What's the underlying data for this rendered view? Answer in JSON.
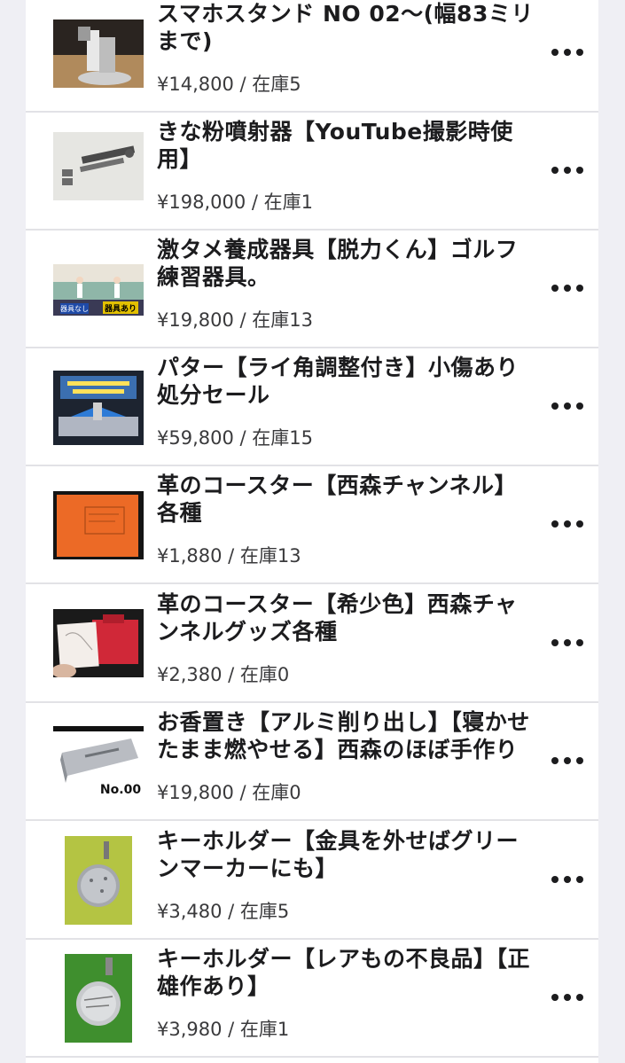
{
  "items": [
    {
      "title": "スマホスタンド NO 02〜(幅83ミリまで)",
      "price": "¥14,800 / 在庫5",
      "thumb_icon": "phone-stand-photo"
    },
    {
      "title": "きな粉噴射器【YouTube撮影時使用】",
      "price": "¥198,000 / 在庫1",
      "thumb_icon": "powder-sprayer-photo"
    },
    {
      "title": "激タメ養成器具【脱力くん】ゴルフ練習器具。",
      "price": "¥19,800 / 在庫13",
      "thumb_icon": "golf-training-photo",
      "thumb_text": [
        "器具なし",
        "器具あり"
      ]
    },
    {
      "title": "パター【ライ角調整付き】小傷あり処分セール",
      "price": "¥59,800 / 在庫15",
      "thumb_icon": "putter-photo"
    },
    {
      "title": "革のコースター【西森チャンネル】各種",
      "price": "¥1,880 / 在庫13",
      "thumb_icon": "leather-coaster-photo"
    },
    {
      "title": "革のコースター【希少色】西森チャンネルグッズ各種",
      "price": "¥2,380 / 在庫0",
      "thumb_icon": "rare-coaster-photo"
    },
    {
      "title": "お香置き【アルミ削り出し】【寝かせたまま燃やせる】西森のほぼ手作り",
      "price": "¥19,800 / 在庫0",
      "thumb_icon": "incense-holder-photo",
      "thumb_text": [
        "No.00"
      ]
    },
    {
      "title": "キーホルダー【金具を外せばグリーンマーカーにも】",
      "price": "¥3,480 / 在庫5",
      "thumb_icon": "keychain-photo"
    },
    {
      "title": "キーホルダー【レアもの不良品】【正雄作あり】",
      "price": "¥3,980 / 在庫1",
      "thumb_icon": "rare-keychain-photo"
    }
  ],
  "more_icon": "ellipsis-icon"
}
